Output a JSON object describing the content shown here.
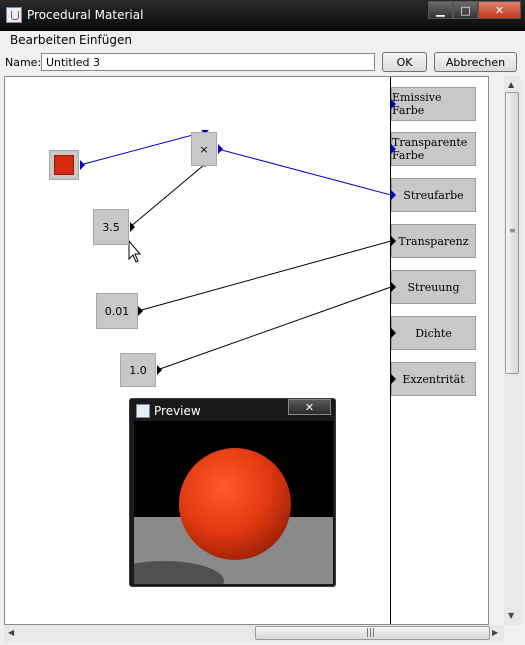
{
  "window": {
    "title": "Procedural Material"
  },
  "menu": [
    "Bearbeiten",
    "Einfügen"
  ],
  "toolbar": {
    "name_label": "Name:",
    "name_value": "Untitled 3",
    "ok_label": "OK",
    "cancel_label": "Abbrechen"
  },
  "nodes": {
    "color_node": {
      "color": "#d82a10"
    },
    "multiply_label": "×",
    "value_35": "3.5",
    "value_001": "0.01",
    "value_10": "1.0"
  },
  "outputs": [
    "Emissive Farbe",
    "Transparente Farbe",
    "Streufarbe",
    "Transparenz",
    "Streuung",
    "Dichte",
    "Exzentrität"
  ],
  "preview": {
    "title": "Preview"
  },
  "colors": {
    "color_wire": "#0000cc",
    "value_wire": "#000000",
    "sphere": "#e23a12"
  }
}
